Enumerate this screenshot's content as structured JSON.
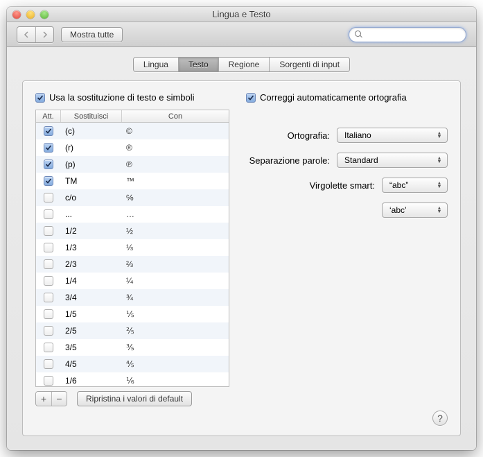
{
  "window": {
    "title": "Lingua e Testo"
  },
  "toolbar": {
    "show_all_label": "Mostra tutte",
    "search_placeholder": ""
  },
  "tabs": {
    "lingua": "Lingua",
    "testo": "Testo",
    "regione": "Regione",
    "sorgenti": "Sorgenti di input"
  },
  "checks": {
    "use_substitution": "Usa la sostituzione di testo e simboli",
    "autocorrect": "Correggi automaticamente ortografia"
  },
  "table": {
    "headers": {
      "att": "Att.",
      "sub": "Sostituisci",
      "con": "Con"
    },
    "rows": [
      {
        "on": true,
        "sub": "(c)",
        "con": "©"
      },
      {
        "on": true,
        "sub": "(r)",
        "con": "®"
      },
      {
        "on": true,
        "sub": "(p)",
        "con": "℗"
      },
      {
        "on": true,
        "sub": "TM",
        "con": "™"
      },
      {
        "on": false,
        "sub": "c/o",
        "con": "℅"
      },
      {
        "on": false,
        "sub": "...",
        "con": "…"
      },
      {
        "on": false,
        "sub": "1/2",
        "con": "½"
      },
      {
        "on": false,
        "sub": "1/3",
        "con": "⅓"
      },
      {
        "on": false,
        "sub": "2/3",
        "con": "⅔"
      },
      {
        "on": false,
        "sub": "1/4",
        "con": "¼"
      },
      {
        "on": false,
        "sub": "3/4",
        "con": "¾"
      },
      {
        "on": false,
        "sub": "1/5",
        "con": "⅕"
      },
      {
        "on": false,
        "sub": "2/5",
        "con": "⅖"
      },
      {
        "on": false,
        "sub": "3/5",
        "con": "⅗"
      },
      {
        "on": false,
        "sub": "4/5",
        "con": "⅘"
      },
      {
        "on": false,
        "sub": "1/6",
        "con": "⅙"
      }
    ]
  },
  "restore_defaults": "Ripristina i valori di default",
  "form": {
    "spelling_label": "Ortografia:",
    "spelling_value": "Italiano",
    "wordbreak_label": "Separazione parole:",
    "wordbreak_value": "Standard",
    "smartquotes_label": "Virgolette smart:",
    "smartquotes_double": "“abc”",
    "smartquotes_single": "‘abc’"
  }
}
